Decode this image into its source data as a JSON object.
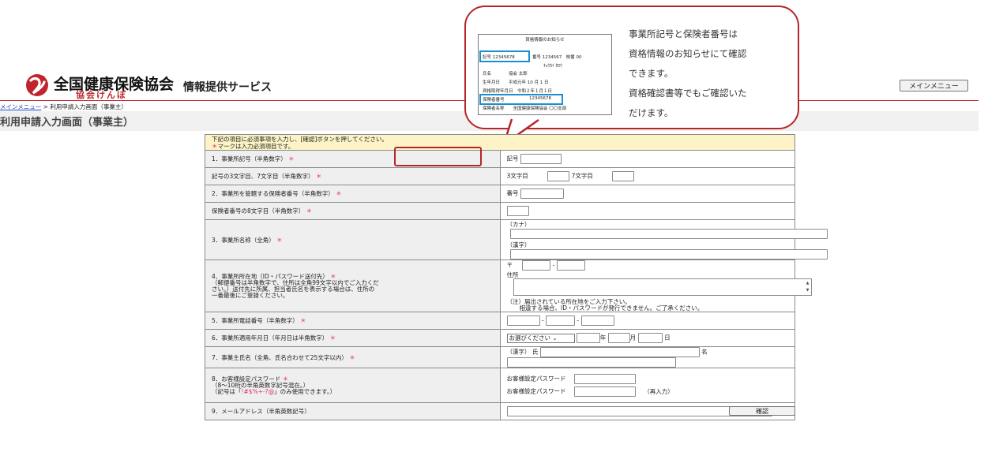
{
  "header": {
    "org_name": "全国健康保険協会",
    "org_sub": "協会けんぽ",
    "service": "情報提供サービス",
    "main_menu_button": "メインメニュー"
  },
  "breadcrumb": {
    "link": "メインメニュー",
    "separator": " > ",
    "current": "利用申請入力画面（事業主）"
  },
  "page_title": "利用申請入力画面（事業主）",
  "callout": {
    "lines": [
      "事業所記号と保険者番号は",
      "資格情報のお知らせにて確認",
      "できます。",
      "資格確認書等でもご確認いた",
      "だけます。"
    ],
    "sample": {
      "title": "資格情報のお知らせ",
      "kigou": "記号 12345678",
      "bangou": "番号 1234567　枝番 00",
      "kana": "ｷｮｳｶｲ ﾀﾛｳ",
      "name": "氏名　　　　協会 太郎",
      "birth": "生年月日　　平成元年 10 月 1 日",
      "acquired": "資格取得年月日　令和２年１月１日",
      "insurer_label": "保険者番号",
      "insurer_no": "12345678",
      "insurer_name": "保険者名称　　全国健康保険協会 〇〇支部"
    },
    "colors": {
      "border": "#b5252a",
      "highlight": "#1a8fd0"
    }
  },
  "form": {
    "note_line1": "下記の項目に必須事項を入力し、[確認]ボタンを押してください。",
    "note_line2": "マークは入力必須項目です。",
    "required_mark": "＊",
    "rows": {
      "kigou": {
        "label": "1．事業所記号（半角数字）",
        "field_label": "記号"
      },
      "kigou_digits": {
        "label": "記号の3文字目、7文字目（半角数字）",
        "third": "3文字目",
        "seventh": "7文字目"
      },
      "insurer": {
        "label": "2．事業所を管轄する保険者番号（半角数字）",
        "field_label": "番号"
      },
      "insurer_digit": {
        "label": "保険者番号の8文字目（半角数字）"
      },
      "office_name": {
        "label": "3．事業所名称（全角）",
        "kana": "（カナ）",
        "kanji": "（漢字）"
      },
      "address": {
        "label_line1": "4．事業所所在地（ID・パスワード送付先）",
        "label_line2": "（郵便番号は半角数字で、住所は全角99文字以内でご入力くだ",
        "label_line3": "さい。）送付先に所属、担当者氏名を表示する場合は、住所の",
        "label_line4": "一番最後にご登録ください。",
        "postal_mark": "〒",
        "dash": "-",
        "address_label": "住所",
        "note1": "（注）届出されている所在地をご入力下さい。",
        "note2": "相違する場合、ID・パスワードが発行できません。ご了承ください。"
      },
      "phone": {
        "label": "5．事業所電話番号（半角数字）",
        "dash": "-"
      },
      "applied_date": {
        "label": "6．事業所適用年月日（年月日は半角数字）",
        "era_select": "お選びください",
        "year": "年",
        "month": "月",
        "day": "日"
      },
      "owner_name": {
        "label": "7．事業主氏名（全角、氏名合わせて25文字以内）",
        "kanji_family": "（漢字） 氏",
        "given": "名"
      },
      "password": {
        "label_line1": "8．お客様設定パスワード",
        "label_line2": "（8～10桁の半角英数字記号混在。）",
        "label_line3_pre": "（記号は「",
        "label_line3_symbols": "!#$%+-?@",
        "label_line3_post": "」のみ使用できます。）",
        "field1": "お客様設定パスワード",
        "field2": "お客様設定パスワード",
        "reenter": "（再入力）"
      },
      "email": {
        "label": "9．メールアドレス（半角英数記号）"
      }
    },
    "confirm_button": "確認"
  }
}
